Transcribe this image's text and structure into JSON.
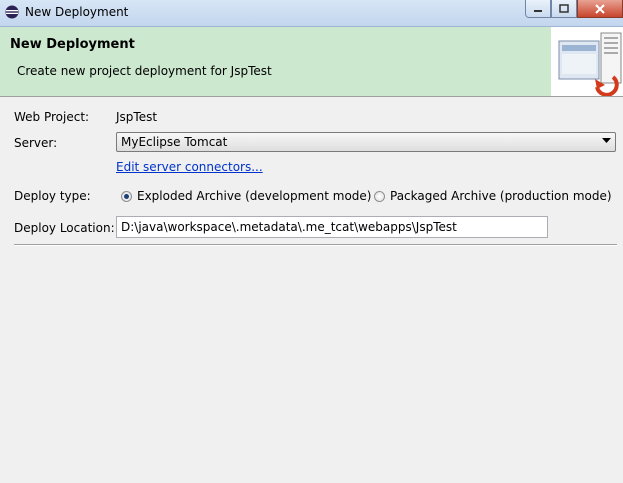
{
  "window": {
    "title": "New Deployment",
    "icon": "eclipse-icon"
  },
  "banner": {
    "title": "New Deployment",
    "description": "Create new project deployment for JspTest",
    "image_icon": "deployment-wizard-icon"
  },
  "form": {
    "web_project_label": "Web Project:",
    "web_project_value": "JspTest",
    "server_label": "Server:",
    "server_value": "MyEclipse Tomcat",
    "edit_connectors_link": "Edit server connectors...",
    "deploy_type_label": "Deploy type:",
    "deploy_type_options": [
      {
        "label": "Exploded Archive (development mode)",
        "selected": true
      },
      {
        "label": "Packaged Archive (production mode)",
        "selected": false
      }
    ],
    "deploy_location_label": "Deploy Location:",
    "deploy_location_value": "D:\\java\\workspace\\.metadata\\.me_tcat\\webapps\\JspTest"
  },
  "colors": {
    "banner_bg": "#cce8cf",
    "link": "#0033cc",
    "close_button": "#c7452c"
  }
}
